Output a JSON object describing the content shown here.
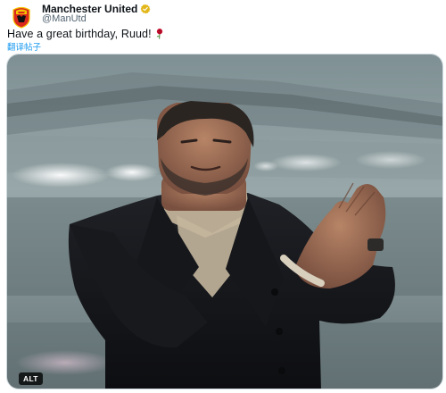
{
  "author": {
    "name": "Manchester United",
    "handle": "@ManUtd",
    "avatar_icon": "manchester-united-crest",
    "verified_icon": "gold-verified-badge",
    "verified_color": "#e2b719"
  },
  "tweet": {
    "text": "Have a great birthday, Ruud!",
    "emoji": "rose-emoji",
    "translate_label": "翻译帖子"
  },
  "media": {
    "alt_label": "ALT",
    "link_color": "#1d9bf0"
  }
}
